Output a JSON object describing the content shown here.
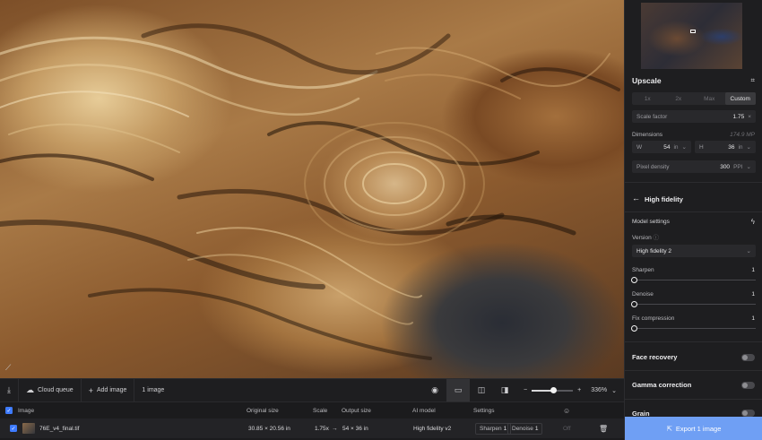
{
  "toolbar": {
    "cloud_queue": "Cloud queue",
    "add_image": "Add image",
    "image_count": "1 image",
    "zoom": "336%"
  },
  "file_list": {
    "headers": {
      "image": "Image",
      "original_size": "Original size",
      "scale": "Scale",
      "output_size": "Output size",
      "ai_model": "AI model",
      "settings": "Settings"
    },
    "rows": [
      {
        "name": "76E_v4_final.tif",
        "original_size": "30.85 × 20.56 in",
        "scale": "1.75x",
        "output_size": "54 × 36 in",
        "ai_model": "High fidelity v2",
        "sharpen_label": "Sharpen",
        "sharpen_value": "1",
        "denoise_label": "Denoise",
        "denoise_value": "1",
        "extra": "Off"
      }
    ]
  },
  "panel": {
    "upscale_title": "Upscale",
    "scale_options": [
      "1x",
      "2x",
      "Max",
      "Custom"
    ],
    "scale_factor_label": "Scale factor",
    "scale_factor_value": "1.75",
    "scale_factor_unit": "×",
    "dimensions_label": "Dimensions",
    "dimensions_mp": "174.9 MP",
    "width_label": "W",
    "width_value": "54",
    "width_unit": "in",
    "height_label": "H",
    "height_value": "36",
    "height_unit": "in",
    "pixel_density_label": "Pixel density",
    "pixel_density_value": "300",
    "pixel_density_unit": "PPI",
    "model_title": "High fidelity",
    "model_settings_label": "Model settings",
    "version_label": "Version",
    "version_value": "High fidelity 2",
    "sharpen_label": "Sharpen",
    "sharpen_value": "1",
    "sharpen_level": 0,
    "denoise_label": "Denoise",
    "denoise_value": "1",
    "denoise_level": 0,
    "fix_compression_label": "Fix compression",
    "fix_compression_value": "1",
    "fix_compression_level": 0,
    "face_recovery_label": "Face recovery",
    "face_recovery_on": false,
    "gamma_correction_label": "Gamma correction",
    "gamma_correction_on": false,
    "grain_label": "Grain",
    "grain_on": false,
    "export_label": "Export 1 image"
  },
  "colors": {
    "accent": "#6f9ff4",
    "checkbox": "#3e7bff",
    "panel_bg": "#1e1e20"
  }
}
